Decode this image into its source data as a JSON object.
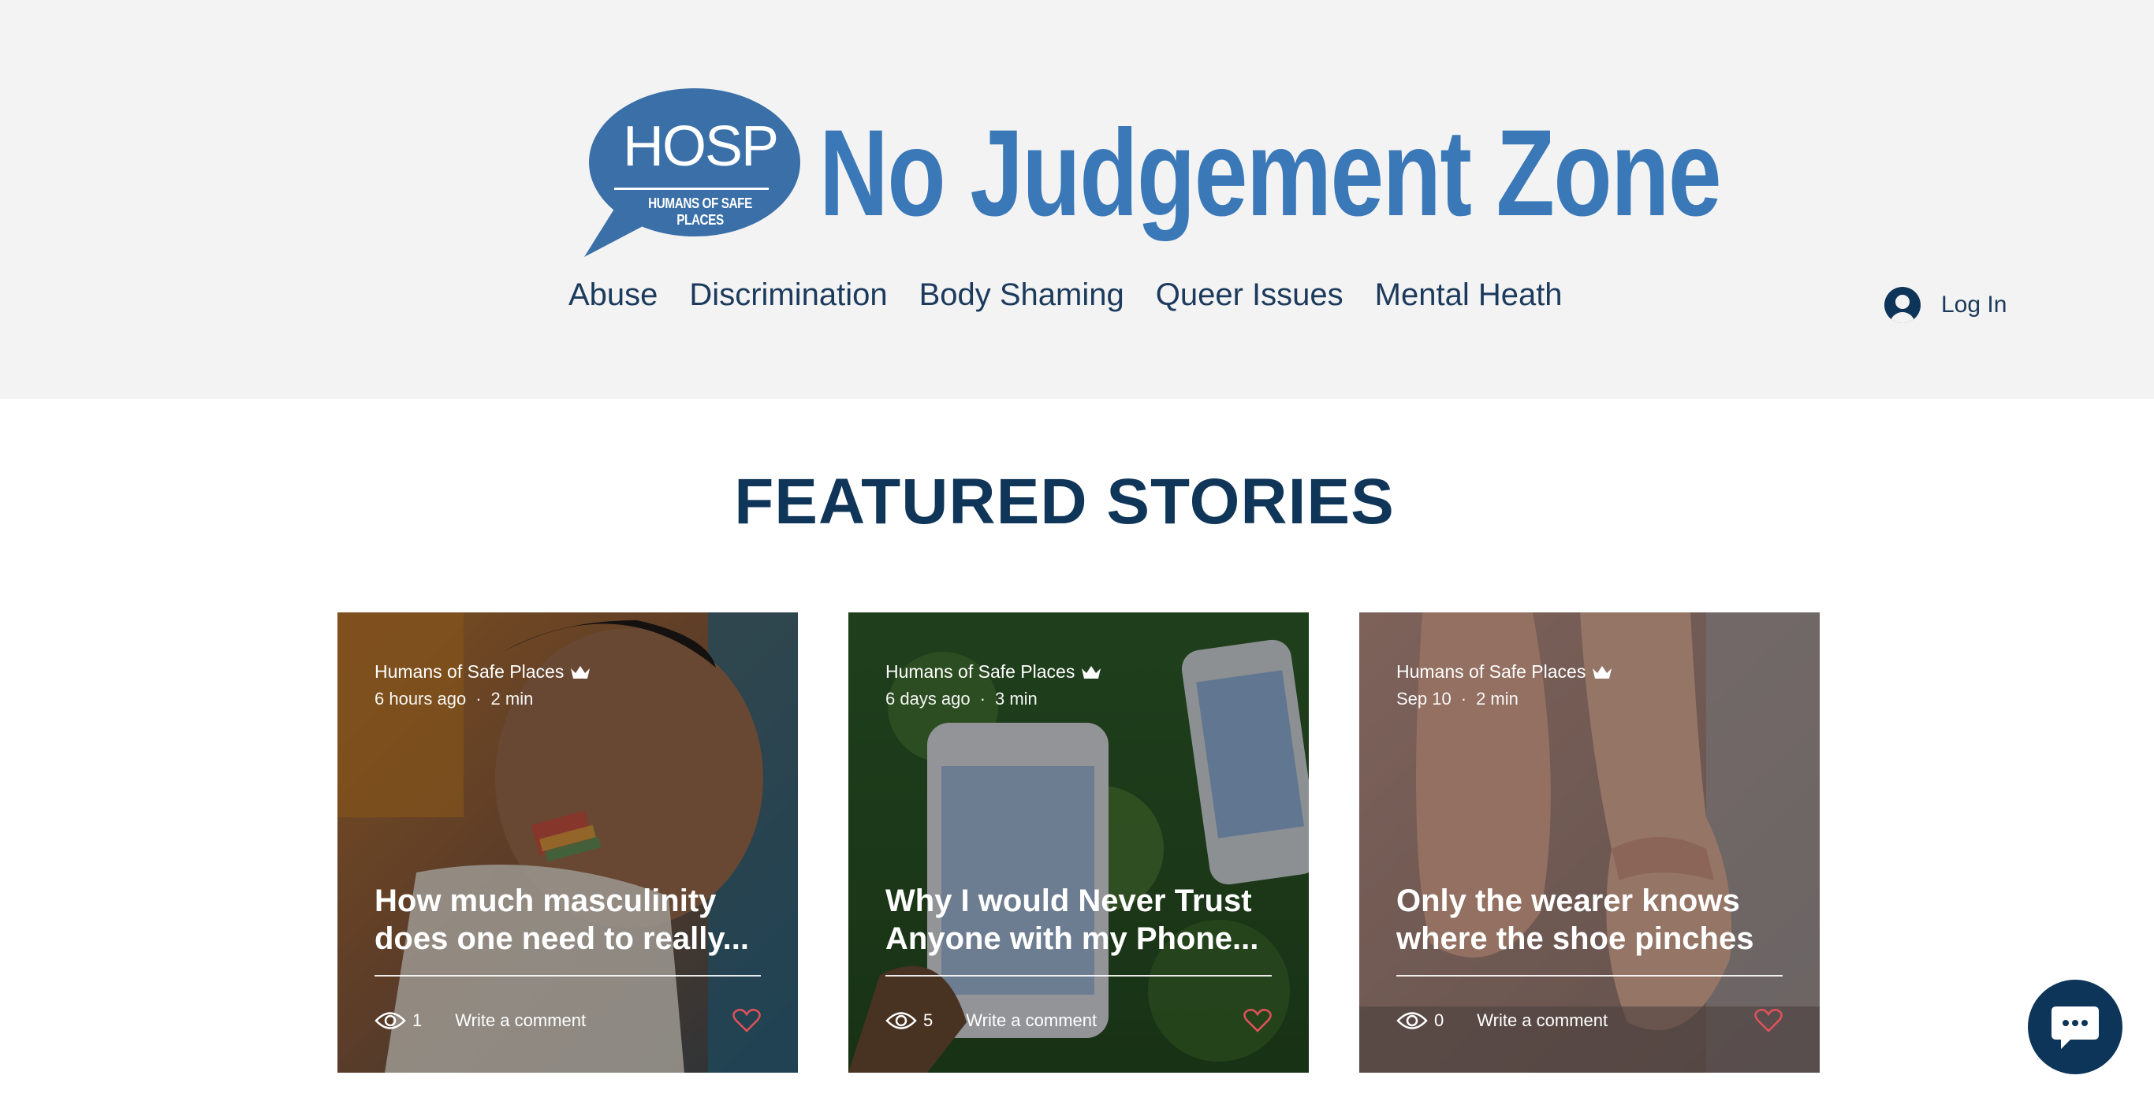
{
  "header": {
    "logo": {
      "mark": "HOSP",
      "tagline": "HUMANS OF SAFE PLACES"
    },
    "site_title": "No Judgement Zone",
    "nav": [
      {
        "label": "Abuse"
      },
      {
        "label": "Discrimination"
      },
      {
        "label": "Body Shaming"
      },
      {
        "label": "Queer Issues"
      },
      {
        "label": "Mental Heath"
      }
    ],
    "login_label": "Log In"
  },
  "featured": {
    "heading": "FEATURED STORIES",
    "cards": [
      {
        "author": "Humans of Safe Places",
        "posted": "6 hours ago",
        "read_time": "2 min",
        "title": "How much masculinity does one need to really...",
        "views": "1",
        "comment_label": "Write a comment"
      },
      {
        "author": "Humans of Safe Places",
        "posted": "6 days ago",
        "read_time": "3 min",
        "title": "Why I would Never Trust Anyone with my Phone...",
        "views": "5",
        "comment_label": "Write a comment"
      },
      {
        "author": "Humans of Safe Places",
        "posted": "Sep 10",
        "read_time": "2 min",
        "title": "Only the wearer knows where the shoe pinches",
        "views": "0",
        "comment_label": "Write a comment"
      }
    ]
  },
  "colors": {
    "header_bg": "#f3f3f3",
    "brand_blue": "#3a78b8",
    "navy": "#0f3558",
    "heart": "#e0525a"
  },
  "icons": {
    "avatar": "user-avatar-icon",
    "crown": "crown-icon",
    "views": "eye-icon",
    "like": "heart-icon",
    "chat": "chat-bubble-icon"
  }
}
